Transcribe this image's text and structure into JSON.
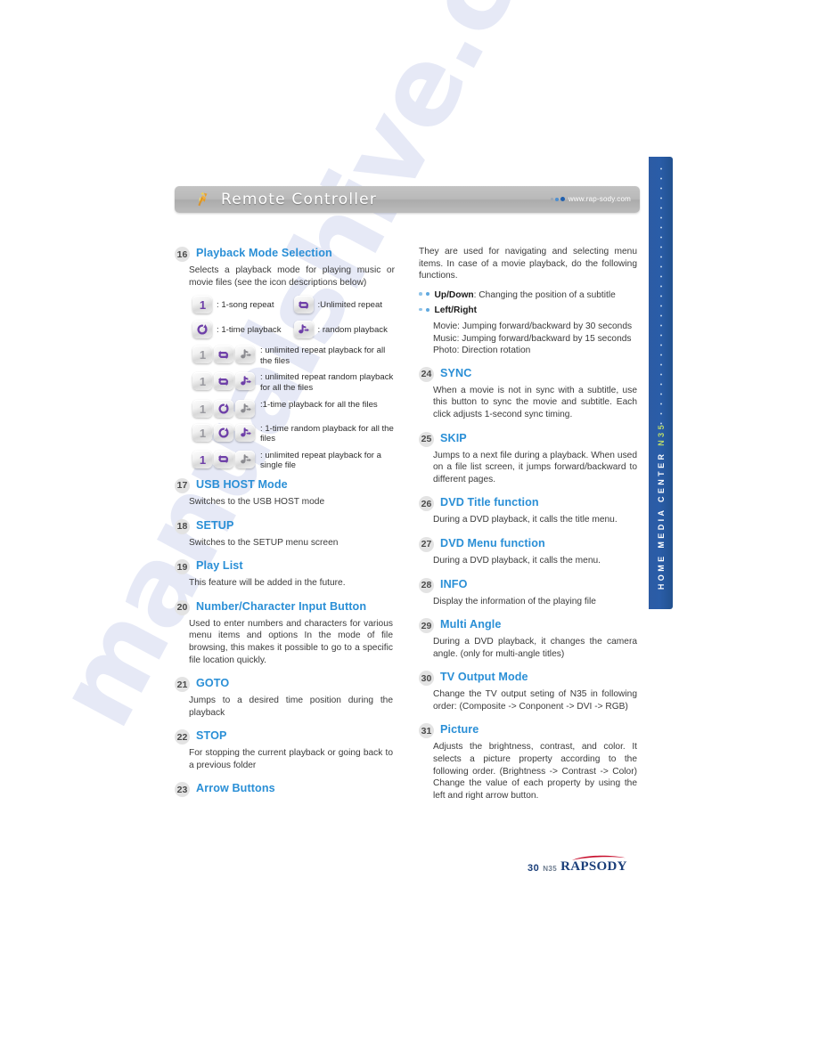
{
  "header": {
    "title": "Remote Controller",
    "url": "www.rap-sody.com",
    "icon": "confetti-icon"
  },
  "side_tab": {
    "text_main": "HOME MEDIA CENTER ",
    "text_model": "N35"
  },
  "watermark": {
    "text": "manualshive.com"
  },
  "left_column": {
    "section_16": {
      "number": "16",
      "title": "Playback Mode Selection",
      "intro": "Selects a playback mode for playing music or movie files (see the icon descriptions below)",
      "pairs": [
        {
          "left_icon": "one-icon",
          "left_label": ": 1-song repeat",
          "right_icon": "repeat-icon",
          "right_label": ":Unlimited repeat"
        },
        {
          "left_icon": "loop-once-icon",
          "left_label": ": 1-time playback",
          "right_icon": "shuffle-note-icon",
          "right_label": ": random playback"
        }
      ],
      "triplets": [
        {
          "icons": [
            "one-icon-gray",
            "repeat-icon-active",
            "shuffle-note-icon-gray"
          ],
          "desc": ": unlimited repeat playback for all the files"
        },
        {
          "icons": [
            "one-icon-gray",
            "repeat-icon-active",
            "shuffle-note-icon-active"
          ],
          "desc": ": unlimited repeat random playback for all the files"
        },
        {
          "icons": [
            "one-icon-gray",
            "loop-once-icon-active",
            "shuffle-note-icon-gray"
          ],
          "desc": ":1-time playback for all the files"
        },
        {
          "icons": [
            "one-icon-gray",
            "loop-once-icon-active",
            "shuffle-note-icon-active"
          ],
          "desc": ": 1-time random playback for all the files"
        },
        {
          "icons": [
            "one-icon-active",
            "repeat-icon-active",
            "shuffle-note-icon-gray"
          ],
          "desc": ": unlimited repeat playback for a single file"
        }
      ]
    },
    "section_17": {
      "number": "17",
      "title": "USB HOST Mode",
      "text": "Switches to the USB HOST mode"
    },
    "section_18": {
      "number": "18",
      "title": "SETUP",
      "text": "Switches to the SETUP menu screen"
    },
    "section_19": {
      "number": "19",
      "title": "Play List",
      "text": "This feature will be added in the future."
    },
    "section_20": {
      "number": "20",
      "title": "Number/Character Input Button",
      "text": "Used to enter numbers and characters for various menu items and options In the mode of file browsing, this makes it possible to go to a specific file location quickly."
    },
    "section_21": {
      "number": "21",
      "title": "GOTO",
      "text": "Jumps to a desired time position during the playback"
    },
    "section_22": {
      "number": "22",
      "title": "STOP",
      "text": "For stopping the current playback or going back to a previous folder"
    },
    "section_23": {
      "number": "23",
      "title": "Arrow Buttons"
    }
  },
  "right_column": {
    "arrow_intro": "They are used for navigating and selecting menu items. In case of a movie playback, do the following functions.",
    "bullets": [
      {
        "label": "Up/Down",
        "rest": ": Changing the position of a subtitle"
      },
      {
        "label": "Left/Right",
        "rest": ""
      }
    ],
    "arrow_details": "Movie: Jumping forward/backward by 30 seconds\nMusic: Jumping forward/backward by 15 seconds\nPhoto: Direction rotation",
    "section_24": {
      "number": "24",
      "title": "SYNC",
      "text": "When a movie is not in sync with a subtitle, use this button to sync the movie and subtitle. Each click adjusts 1-second sync timing."
    },
    "section_25": {
      "number": "25",
      "title": "SKIP",
      "text": "Jumps to a next file during a playback. When used on a file list screen, it jumps forward/backward to different pages."
    },
    "section_26": {
      "number": "26",
      "title": "DVD Title function",
      "text": "During a DVD playback, it calls the title menu."
    },
    "section_27": {
      "number": "27",
      "title": "DVD Menu function",
      "text": "During a DVD playback, it calls the menu."
    },
    "section_28": {
      "number": "28",
      "title": "INFO",
      "text": "Display the information of the playing file"
    },
    "section_29": {
      "number": "29",
      "title": "Multi Angle",
      "text": "During a DVD playback, it changes the camera angle. (only for multi-angle titles)"
    },
    "section_30": {
      "number": "30",
      "title": "TV Output Mode",
      "text": "Change the TV output seting of N35 in following order: (Composite -> Conponent -> DVI -> RGB)"
    },
    "section_31": {
      "number": "31",
      "title": "Picture",
      "text": "Adjusts the brightness, contrast, and color. It selects a picture property according to the following order. (Brightness -> Contrast -> Color) Change the value of each property by using the left and right arrow button."
    }
  },
  "footer": {
    "page_number": "30",
    "model": "N35",
    "brand": "RAPSODY"
  },
  "colors": {
    "heading_blue": "#2a8fd6",
    "tab_blue": "#2a5da8",
    "icon_purple": "#6e3fa8",
    "icon_gray": "#8b8b90",
    "brand_navy": "#1b3f7a"
  }
}
